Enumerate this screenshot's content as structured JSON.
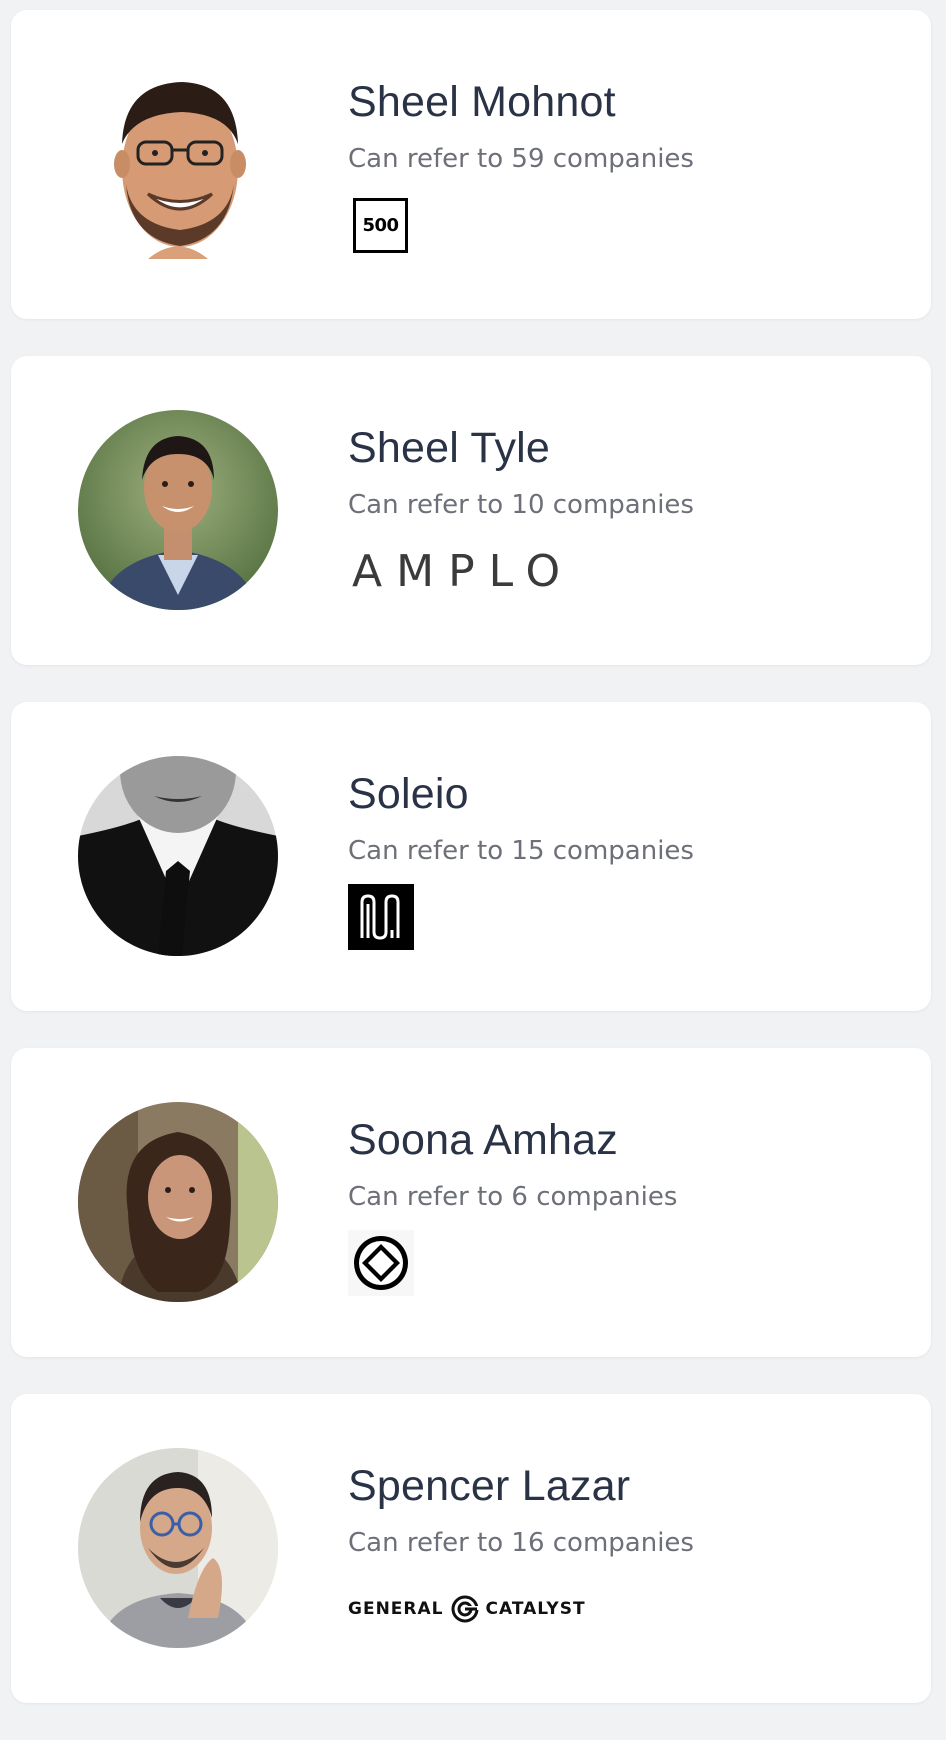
{
  "referrers": [
    {
      "name": "Sheel Mohnot",
      "refer_text": "Can refer to 59 companies",
      "avatar": "cartoon-portrait",
      "logo": {
        "icon": "500-startups-logo",
        "text": "500"
      }
    },
    {
      "name": "Sheel Tyle",
      "refer_text": "Can refer to 10 companies",
      "avatar": "photo-portrait",
      "logo": {
        "icon": "amplo-logo",
        "text": "AMPLO"
      }
    },
    {
      "name": "Soleio",
      "refer_text": "Can refer to 15 companies",
      "avatar": "bw-photo-portrait",
      "logo": {
        "icon": "wavy-lines-logo"
      }
    },
    {
      "name": "Soona Amhaz",
      "refer_text": "Can refer to 6 companies",
      "avatar": "photo-portrait",
      "logo": {
        "icon": "diamond-circle-logo"
      }
    },
    {
      "name": "Spencer Lazar",
      "refer_text": "Can refer to 16 companies",
      "avatar": "photo-portrait",
      "logo": {
        "icon": "general-catalyst-logo",
        "text_left": "GENERAL",
        "text_right": "CATALYST"
      }
    }
  ],
  "colors": {
    "page_background": "#f1f2f4",
    "card_background": "#ffffff",
    "name_text": "#2a3346",
    "secondary_text": "#6d7078"
  }
}
